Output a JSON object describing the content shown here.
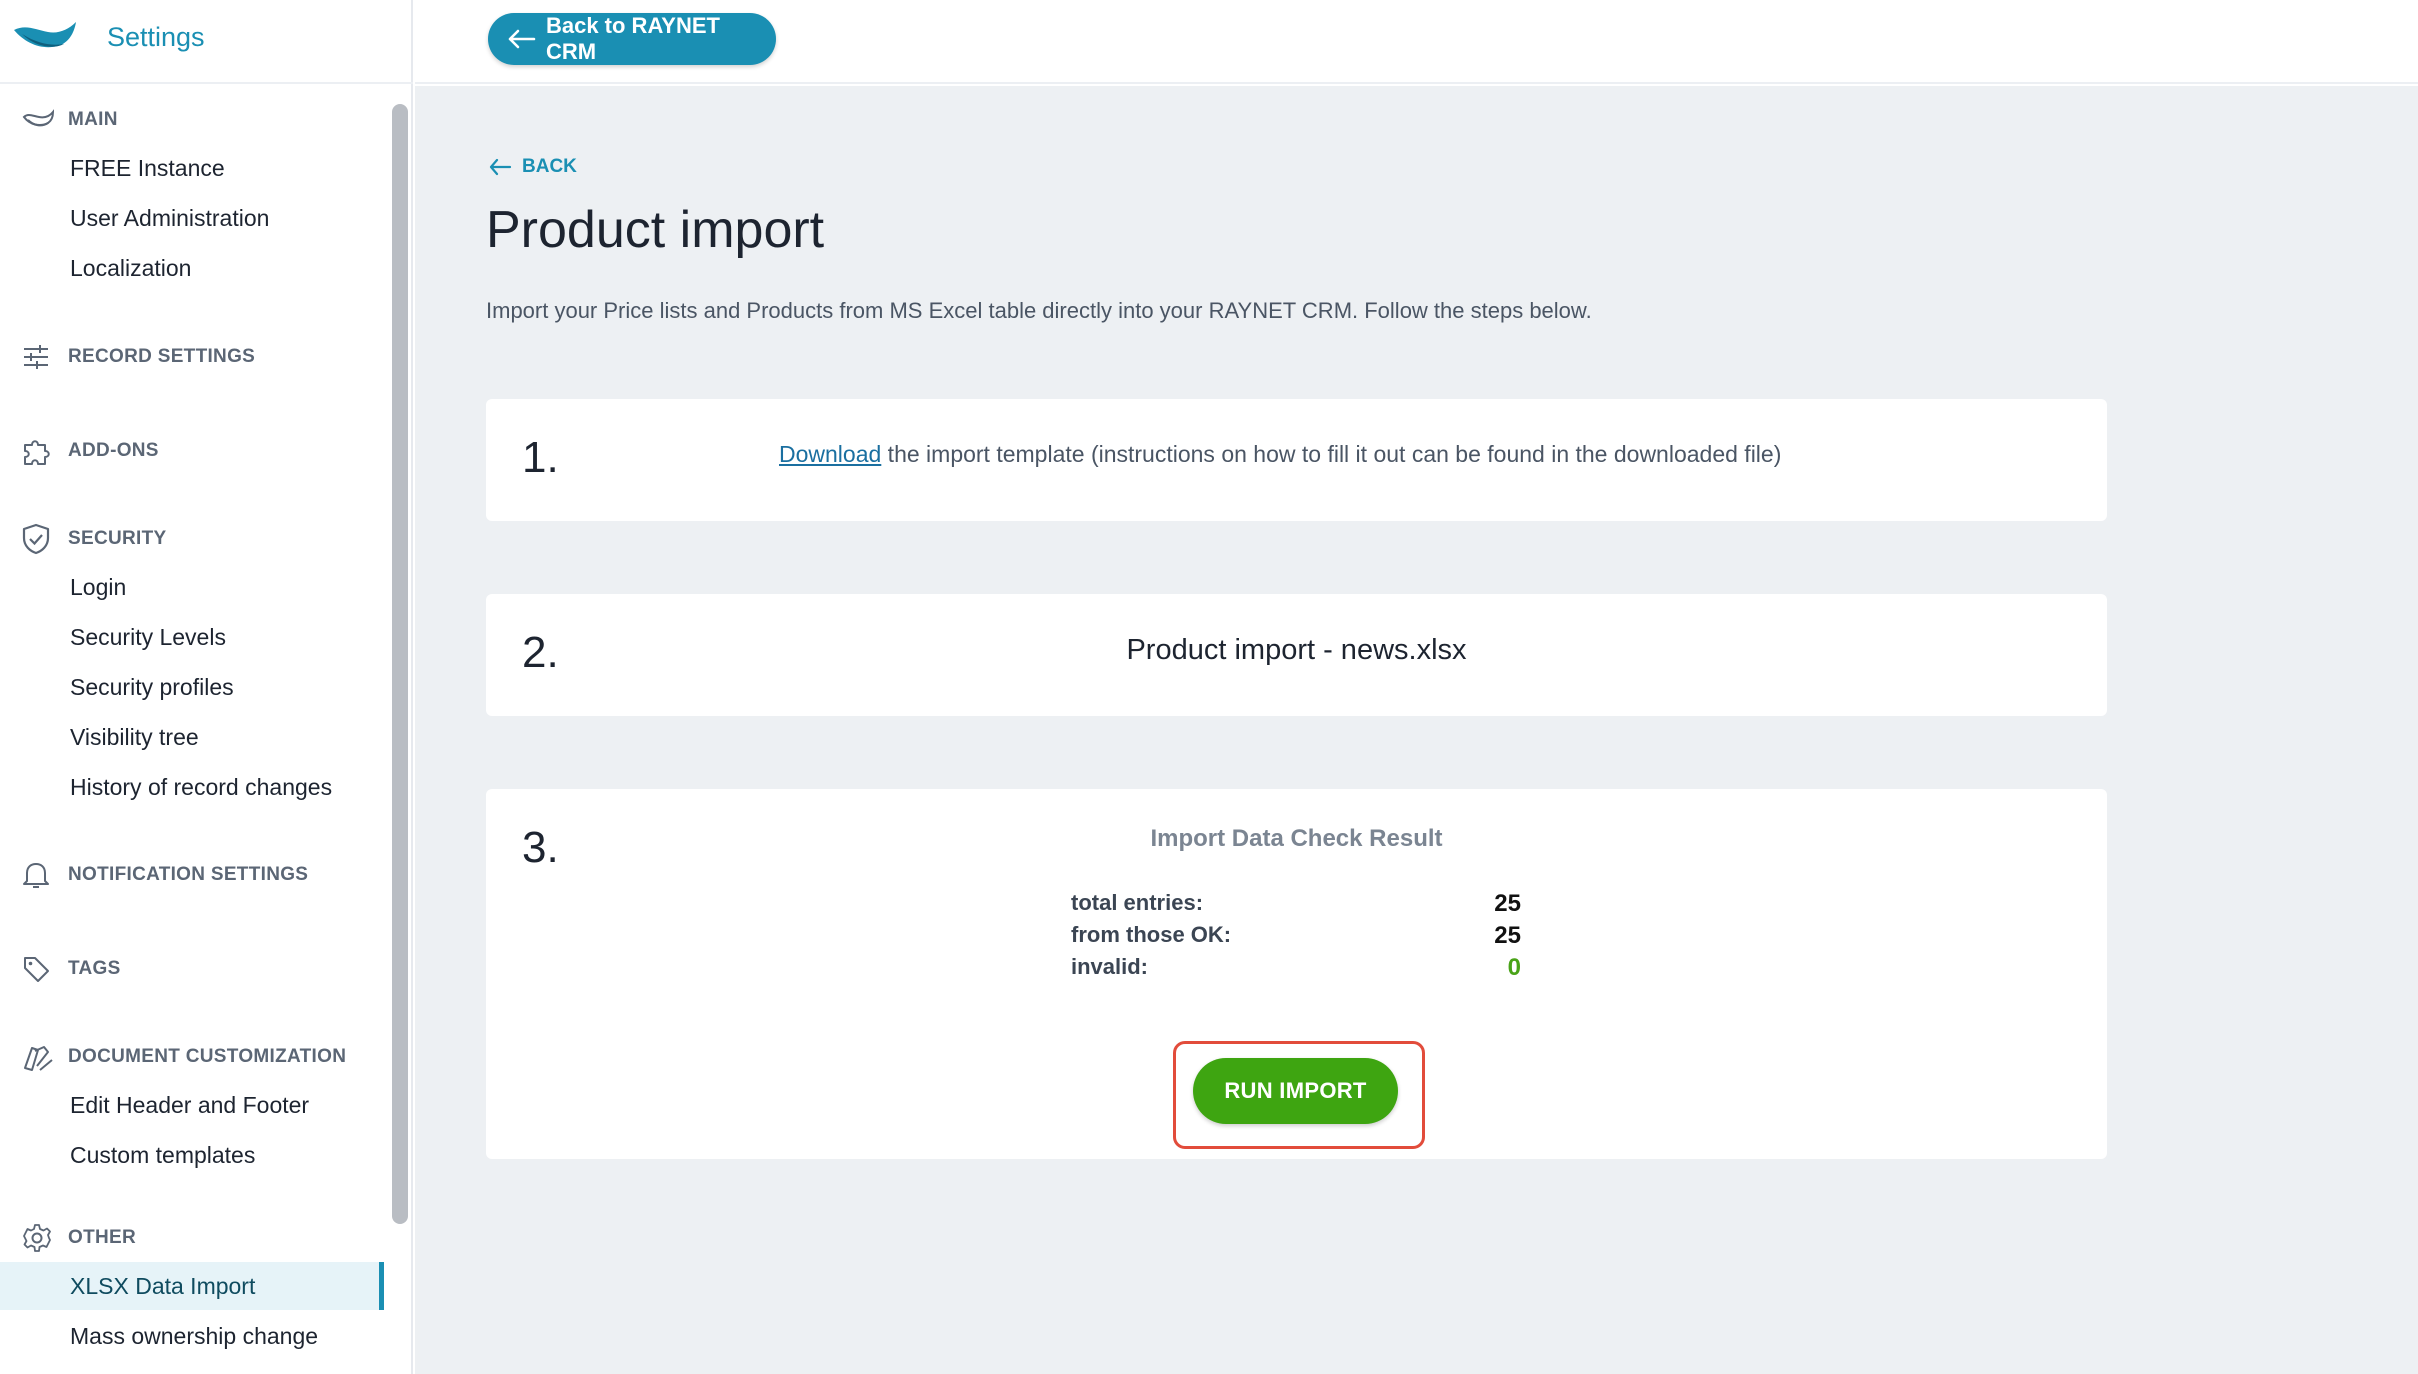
{
  "app": {
    "title": "Settings"
  },
  "topbar": {
    "back_crm_label": "Back to RAYNET CRM"
  },
  "sidebar": {
    "sections": [
      {
        "key": "main",
        "title": "MAIN",
        "icon": "raynet-icon",
        "items": [
          "FREE Instance",
          "User Administration",
          "Localization"
        ]
      },
      {
        "key": "record",
        "title": "RECORD SETTINGS",
        "icon": "sliders-icon",
        "items": []
      },
      {
        "key": "addons",
        "title": "ADD-ONS",
        "icon": "puzzle-icon",
        "items": []
      },
      {
        "key": "security",
        "title": "SECURITY",
        "icon": "shield-icon",
        "items": [
          "Login",
          "Security Levels",
          "Security profiles",
          "Visibility tree",
          "History of record changes"
        ]
      },
      {
        "key": "notification",
        "title": "NOTIFICATION SETTINGS",
        "icon": "bell-icon",
        "items": []
      },
      {
        "key": "tags",
        "title": "TAGS",
        "icon": "tag-icon",
        "items": []
      },
      {
        "key": "document",
        "title": "DOCUMENT CUSTOMIZATION",
        "icon": "palette-icon",
        "items": [
          "Edit Header and Footer",
          "Custom templates"
        ]
      },
      {
        "key": "other",
        "title": "OTHER",
        "icon": "gear-icon",
        "items": [
          "XLSX Data Import",
          "Mass ownership change"
        ]
      }
    ],
    "active_item": "XLSX Data Import"
  },
  "main": {
    "back_label": "BACK",
    "title": "Product import",
    "intro": "Import your Price lists and Products from MS Excel table directly into your RAYNET CRM. Follow the steps below.",
    "step1": {
      "number": "1.",
      "link": "Download",
      "text": " the import template (instructions on how to fill it out can be found in the downloaded file)"
    },
    "step2": {
      "number": "2.",
      "text": "Product import - news.xlsx"
    },
    "step3": {
      "number": "3.",
      "result_title": "Import Data Check Result",
      "rows": [
        {
          "label": "total entries:",
          "value": "25"
        },
        {
          "label": "from those OK:",
          "value": "25"
        },
        {
          "label": "invalid:",
          "value": "0"
        }
      ],
      "run_label": "RUN IMPORT"
    }
  },
  "colors": {
    "accent": "#1a8fb3",
    "success": "#3ea511",
    "highlight": "#e24c3b",
    "background": "#edf0f3"
  }
}
